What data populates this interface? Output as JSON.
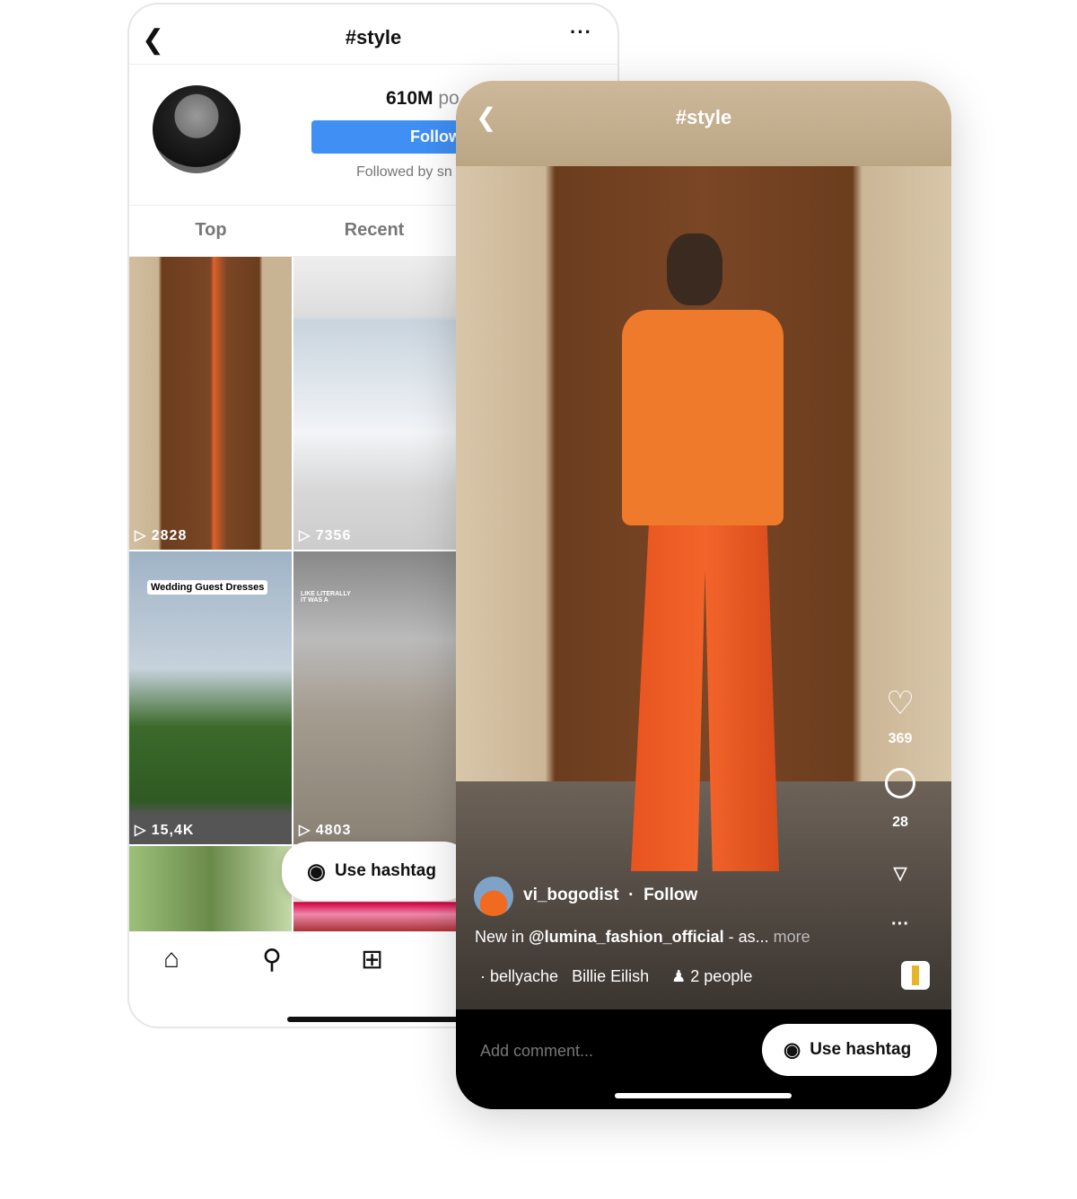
{
  "back_screen": {
    "title": "#style",
    "back_icon": "chevron-left-icon",
    "more_icon": "more-horizontal-icon",
    "posts_count": "610M",
    "posts_label": "po",
    "follow_label": "Follow",
    "followed_by": "Followed by sn",
    "tabs": [
      {
        "label": "Top"
      },
      {
        "label": "Recent"
      }
    ],
    "grid": [
      {
        "count": "2828"
      },
      {
        "count": "7356"
      },
      {
        "count": "15,4K",
        "overlay_text": "Wedding Guest Dresses"
      },
      {
        "count": "4803",
        "overlay_text": "LIKE LITERALLY IT WAS A"
      }
    ],
    "use_hashtag": "Use hashtag",
    "nav": [
      "home-icon",
      "search-icon",
      "plus-square-icon"
    ]
  },
  "front_screen": {
    "title": "#style",
    "likes": "369",
    "comments": "28",
    "username": "vi_bogodist",
    "follow_label": "Follow",
    "caption_prefix": "New in ",
    "caption_mention": "@lumina_fashion_official",
    "caption_rest": " - as...",
    "caption_more": " more",
    "song": "bellyache",
    "artist": "Billie Eilish",
    "people": "2 people",
    "comment_placeholder": "Add comment...",
    "use_hashtag": "Use hashtag"
  },
  "colors": {
    "follow_blue": "#3f8ff5",
    "accent_orange": "#f07a2c"
  }
}
